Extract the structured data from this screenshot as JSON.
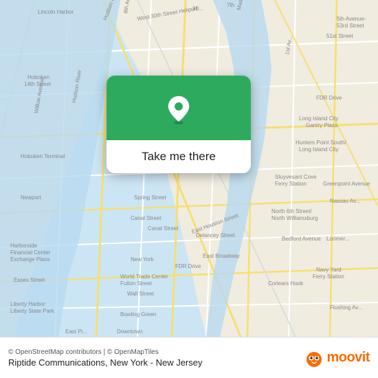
{
  "map": {
    "attribution": "© OpenStreetMap contributors | © OpenMapTiles",
    "location_name": "Riptide Communications, New York - New Jersey"
  },
  "popup": {
    "label": "Take me there"
  },
  "moovit": {
    "text": "moovit"
  }
}
